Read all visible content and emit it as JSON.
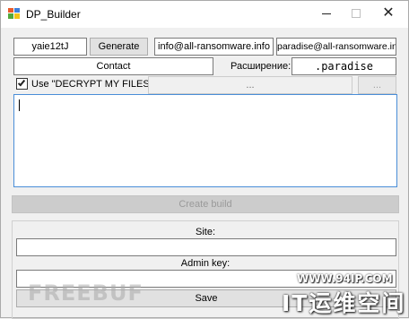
{
  "window": {
    "title": "DP_Builder",
    "minimize_glyph": "",
    "close_glyph": "✕",
    "icon": "app-grid-icon"
  },
  "row1": {
    "key_value": "yaie12tJ",
    "generate_label": "Generate",
    "email1_value": "info@all-ransomware.info",
    "email2_value": "paradise@all-ransomware.info"
  },
  "row2": {
    "contact_value": "Contact",
    "extension_label": "Расширение:",
    "extension_value": ".paradise"
  },
  "row3": {
    "checkbox_checked": true,
    "checkbox_label": "Use \"DECRYPT MY FILES\"",
    "path_value": "...",
    "browse_label": "..."
  },
  "note_text": "",
  "create_build_label": "Create build",
  "group": {
    "site_label": "Site:",
    "site_value": "",
    "admin_key_label": "Admin key:",
    "admin_key_value": "",
    "save_label": "Save"
  },
  "watermarks": {
    "left": "FREEBUF",
    "url": "WWW.94IP.COM",
    "cn": "IT运维空间"
  }
}
